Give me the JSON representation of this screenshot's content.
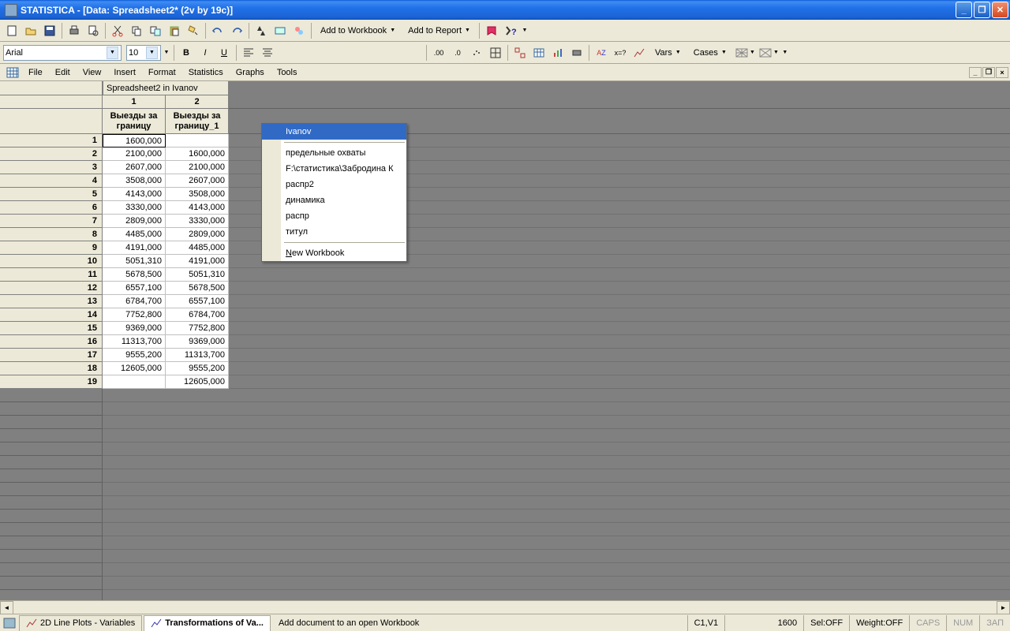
{
  "window": {
    "title": "STATISTICA - [Data: Spreadsheet2* (2v by 19c)]"
  },
  "toolbar1": {
    "add_workbook": "Add to Workbook",
    "add_report": "Add to Report"
  },
  "toolbar2": {
    "font": "Arial",
    "size": "10",
    "vars": "Vars",
    "cases": "Cases"
  },
  "menu": {
    "file": "File",
    "edit": "Edit",
    "view": "View",
    "insert": "Insert",
    "format": "Format",
    "statistics": "Statistics",
    "graphs": "Graphs",
    "tools": "Tools"
  },
  "dropdown": {
    "items": [
      "Ivanov",
      "предельные охваты",
      "F:\\статистика\\Забродина К",
      "распр2",
      "динамика",
      "распр",
      "титул"
    ],
    "new_workbook": "New Workbook",
    "new_prefix": "N"
  },
  "sheet": {
    "title": "Spreadsheet2 in Ivanov",
    "colnums": [
      "1",
      "2"
    ],
    "colnames": [
      "Выезды за границу",
      "Выезды за границу_1"
    ],
    "rows": [
      {
        "n": "1",
        "a": "1600,000",
        "b": ""
      },
      {
        "n": "2",
        "a": "2100,000",
        "b": "1600,000"
      },
      {
        "n": "3",
        "a": "2607,000",
        "b": "2100,000"
      },
      {
        "n": "4",
        "a": "3508,000",
        "b": "2607,000"
      },
      {
        "n": "5",
        "a": "4143,000",
        "b": "3508,000"
      },
      {
        "n": "6",
        "a": "3330,000",
        "b": "4143,000"
      },
      {
        "n": "7",
        "a": "2809,000",
        "b": "3330,000"
      },
      {
        "n": "8",
        "a": "4485,000",
        "b": "2809,000"
      },
      {
        "n": "9",
        "a": "4191,000",
        "b": "4485,000"
      },
      {
        "n": "10",
        "a": "5051,310",
        "b": "4191,000"
      },
      {
        "n": "11",
        "a": "5678,500",
        "b": "5051,310"
      },
      {
        "n": "12",
        "a": "6557,100",
        "b": "5678,500"
      },
      {
        "n": "13",
        "a": "6784,700",
        "b": "6557,100"
      },
      {
        "n": "14",
        "a": "7752,800",
        "b": "6784,700"
      },
      {
        "n": "15",
        "a": "9369,000",
        "b": "7752,800"
      },
      {
        "n": "16",
        "a": "11313,700",
        "b": "9369,000"
      },
      {
        "n": "17",
        "a": "9555,200",
        "b": "11313,700"
      },
      {
        "n": "18",
        "a": "12605,000",
        "b": "9555,200"
      },
      {
        "n": "19",
        "a": "",
        "b": "12605,000"
      }
    ]
  },
  "tabs": {
    "t1": "2D Line Plots - Variables",
    "t2": "Transformations of Va..."
  },
  "status": {
    "hint": "Add document to an open Workbook",
    "cell": "C1,V1",
    "val": "1600",
    "sel": "Sel:OFF",
    "weight": "Weight:OFF",
    "caps": "CAPS",
    "num": "NUM",
    "rec": "ЗАП"
  }
}
